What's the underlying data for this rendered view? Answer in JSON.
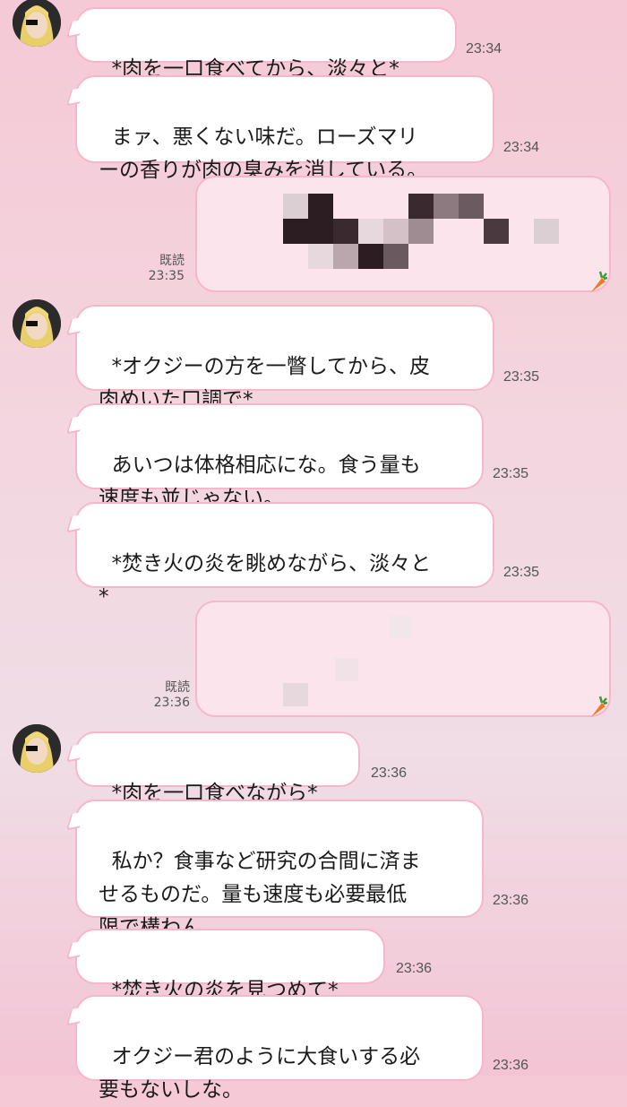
{
  "messages": [
    {
      "text": "*肉を一口食べてから、淡々と*",
      "time": "23:34"
    },
    {
      "text": "まァ、悪くない味だ。ローズマリ\nーの香りが肉の臭みを消している。",
      "time": "23:34"
    },
    {
      "read": "既読",
      "time": "23:35"
    },
    {
      "text": "*オクジーの方を一瞥してから、皮\n肉めいた口調で*",
      "time": "23:35"
    },
    {
      "text": "あいつは体格相応にな。食う量も\n速度も並じゃない。",
      "time": "23:35"
    },
    {
      "text": "*焚き火の炎を眺めながら、淡々と\n*",
      "time": "23:35"
    },
    {
      "read": "既読",
      "time": "23:36"
    },
    {
      "text": "*肉を一口食べながら*",
      "time": "23:36"
    },
    {
      "text": "私か？食事など研究の合間に済ま\nせるものだ。量も速度も必要最低\n限で構わん。",
      "time": "23:36"
    },
    {
      "text": "*焚き火の炎を見つめて*",
      "time": "23:36"
    },
    {
      "text": "オクジー君のように大食いする必\n要もないしな。",
      "time": "23:36"
    }
  ],
  "colors": {
    "bubble_border": "#f7b6c9",
    "sent_bubble": "#fbe4ec"
  },
  "icons": [
    "avatar",
    "carrot-icon"
  ]
}
